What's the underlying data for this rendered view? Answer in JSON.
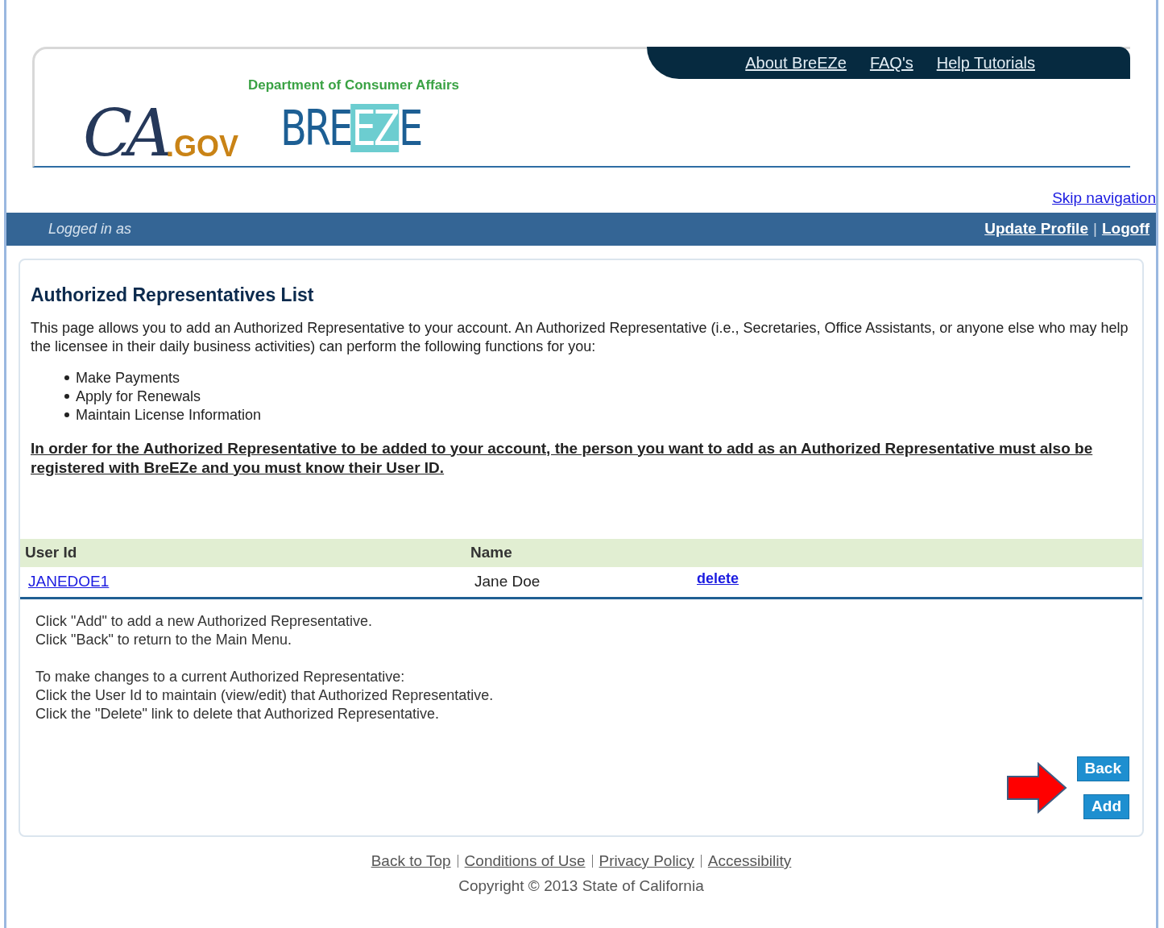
{
  "header": {
    "logo_ca": "CA",
    "logo_gov": ".GOV",
    "department": "Department of Consumer Affairs",
    "breeze_logo": [
      "BRE",
      "EZ",
      "E"
    ],
    "nav_links": [
      "About BreEZe",
      "FAQ's",
      "Help Tutorials"
    ]
  },
  "skip_link": "Skip navigation",
  "user_bar": {
    "logged_in": "Logged in as",
    "links": [
      "Update Profile",
      "Logoff"
    ],
    "separator": "|"
  },
  "page": {
    "title": "Authorized Representatives List",
    "intro": "This page allows you to add an Authorized Representative to your account. An Authorized Representative (i.e., Secretaries, Office Assistants, or anyone else who may help the licensee in their daily business activities) can perform the following functions for you:",
    "functions": [
      "Make Payments",
      "Apply for Renewals",
      "Maintain License Information"
    ],
    "notice": "In order for the Authorized Representative to be added to your account, the person you want to add as an Authorized Representative must also be registered with BreEZe and you must know their User ID.",
    "table": {
      "columns": [
        "User Id",
        "Name"
      ],
      "rows": [
        {
          "user_id": "JANEDOE1",
          "name": "Jane Doe",
          "action": "delete"
        }
      ]
    },
    "instructions": [
      [
        "Click \"Add\" to add a new Authorized Representative.",
        "Click \"Back\" to return to the Main Menu."
      ],
      [
        "To make changes to a current Authorized Representative:",
        "Click the User Id to maintain (view/edit) that Authorized Representative.",
        "Click the \"Delete\" link to delete that Authorized Representative."
      ]
    ],
    "buttons": [
      "Back",
      "Add"
    ]
  },
  "footer": {
    "links": [
      "Back to Top",
      "Conditions of Use",
      "Privacy Policy",
      "Accessibility"
    ],
    "copyright": "Copyright © 2013 State of California"
  }
}
